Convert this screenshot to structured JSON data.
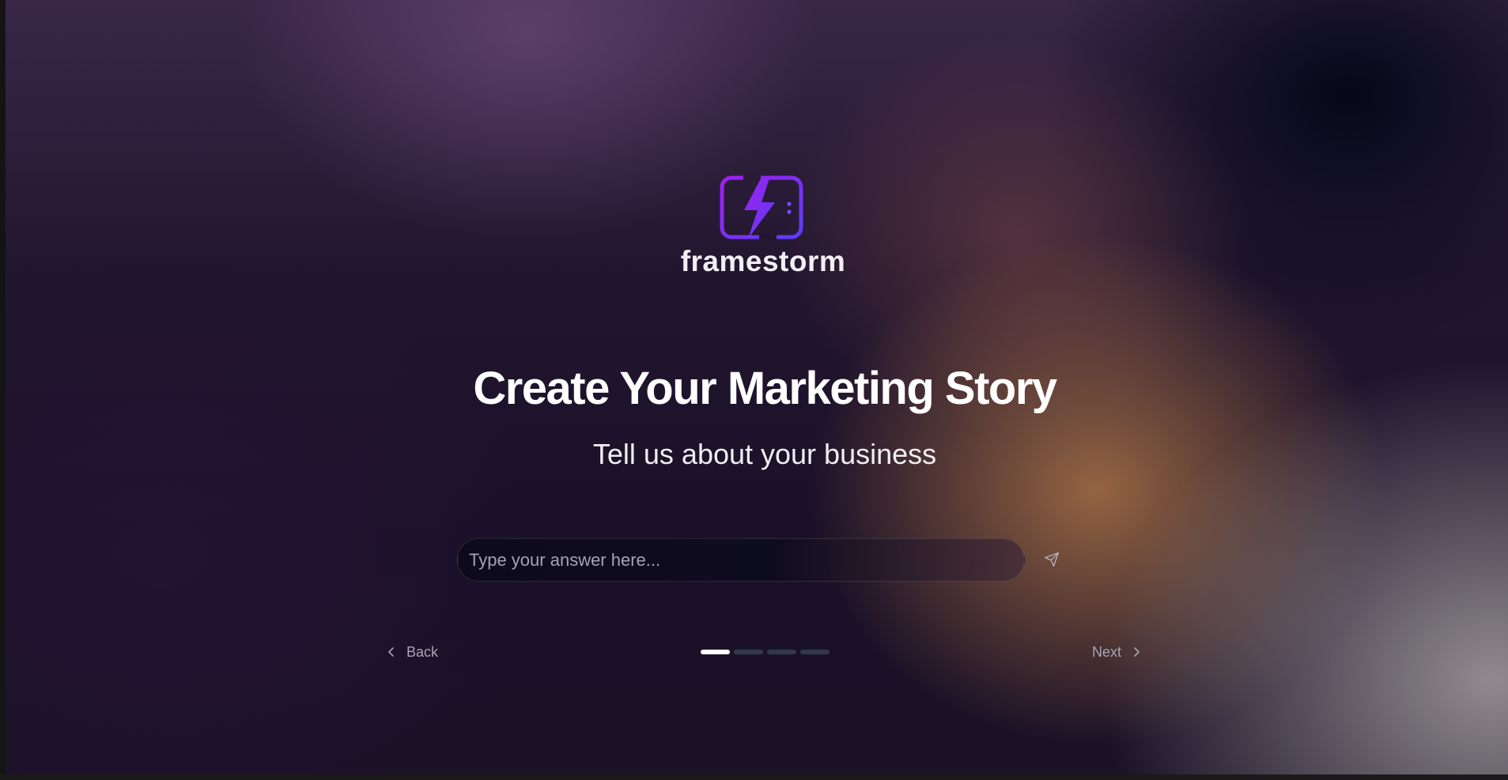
{
  "brand": {
    "name": "framestorm",
    "logo_icon": "lightning-screen-icon",
    "logo_gradient": [
      "#a020f0",
      "#5b3df5"
    ]
  },
  "main": {
    "title": "Create Your Marketing Story",
    "subtitle": "Tell us about your business"
  },
  "answer": {
    "placeholder": "Type your answer here...",
    "value": "",
    "send_icon": "send-icon"
  },
  "navigation": {
    "back_label": "Back",
    "next_label": "Next",
    "back_icon": "chevron-left-icon",
    "next_icon": "chevron-right-icon"
  },
  "progress": {
    "total_steps": 4,
    "current_step": 1,
    "active_color": "#ffffff",
    "inactive_color": "#333848"
  }
}
